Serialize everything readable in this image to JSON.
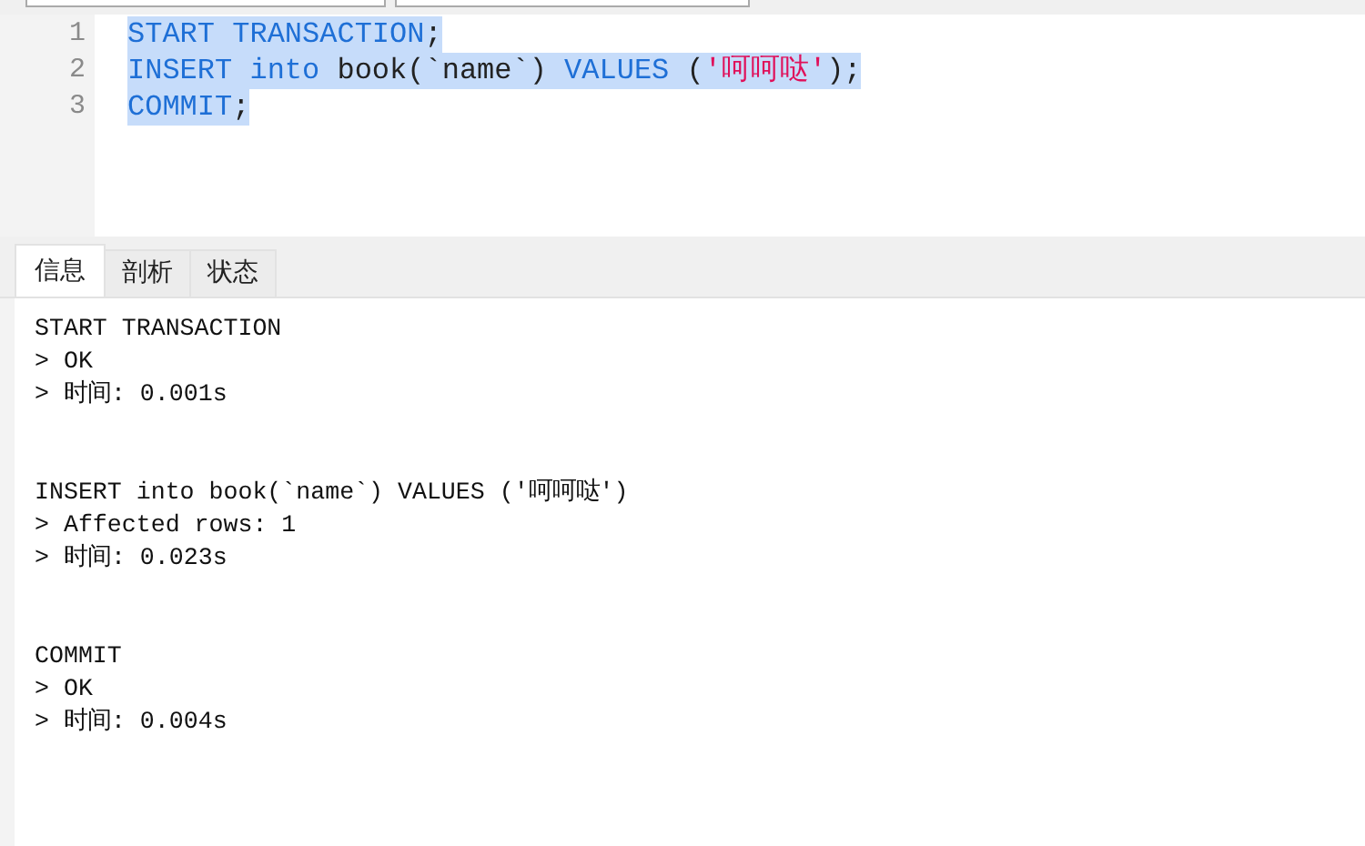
{
  "editor": {
    "lines": [
      {
        "number": "1",
        "selected": true,
        "tokens": [
          {
            "kind": "keyword",
            "text": "START TRANSACTION"
          },
          {
            "kind": "plain",
            "text": ";"
          }
        ]
      },
      {
        "number": "2",
        "selected": true,
        "tokens": [
          {
            "kind": "keyword",
            "text": "INSERT into"
          },
          {
            "kind": "plain",
            "text": " book(`name`) "
          },
          {
            "kind": "keyword",
            "text": "VALUES"
          },
          {
            "kind": "plain",
            "text": " ("
          },
          {
            "kind": "string",
            "text": "'呵呵哒'"
          },
          {
            "kind": "plain",
            "text": ");"
          }
        ]
      },
      {
        "number": "3",
        "selected": true,
        "tokens": [
          {
            "kind": "keyword",
            "text": "COMMIT"
          },
          {
            "kind": "plain",
            "text": ";"
          }
        ]
      }
    ]
  },
  "tabs": [
    {
      "label": "信息",
      "selected": true
    },
    {
      "label": "剖析",
      "selected": false
    },
    {
      "label": "状态",
      "selected": false
    }
  ],
  "messages": [
    {
      "statement": "START TRANSACTION",
      "results": [
        "> OK",
        "> 时间: 0.001s"
      ]
    },
    {
      "statement": "INSERT into book(`name`) VALUES ('呵呵哒')",
      "results": [
        "> Affected rows: 1",
        "> 时间: 0.023s"
      ]
    },
    {
      "statement": "COMMIT",
      "results": [
        "> OK",
        "> 时间: 0.004s"
      ]
    }
  ]
}
